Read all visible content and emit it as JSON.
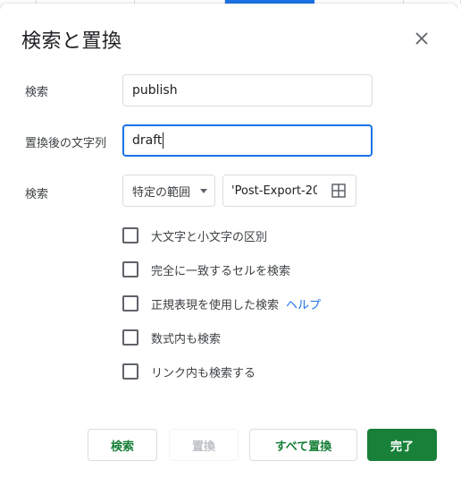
{
  "dialog": {
    "title": "検索と置換"
  },
  "find": {
    "label": "検索",
    "value": "publish"
  },
  "replace": {
    "label": "置換後の文字列",
    "value": "draft"
  },
  "search": {
    "label": "検索",
    "scope_selected": "特定の範囲",
    "range_value": "'Post-Export-20"
  },
  "options": [
    {
      "label": "大文字と小文字の区別",
      "checked": false
    },
    {
      "label": "完全に一致するセルを検索",
      "checked": false
    },
    {
      "label": "正規表現を使用した検索",
      "checked": false
    },
    {
      "label": "数式内も検索",
      "checked": false
    },
    {
      "label": "リンク内も検索する",
      "checked": false
    }
  ],
  "help_link": "ヘルプ",
  "buttons": {
    "find": "検索",
    "replace": "置換",
    "replace_all": "すべて置換",
    "done": "完了"
  },
  "colors": {
    "accent_green": "#188038",
    "focus_blue": "#1a73e8",
    "link_blue": "#1a73e8"
  }
}
